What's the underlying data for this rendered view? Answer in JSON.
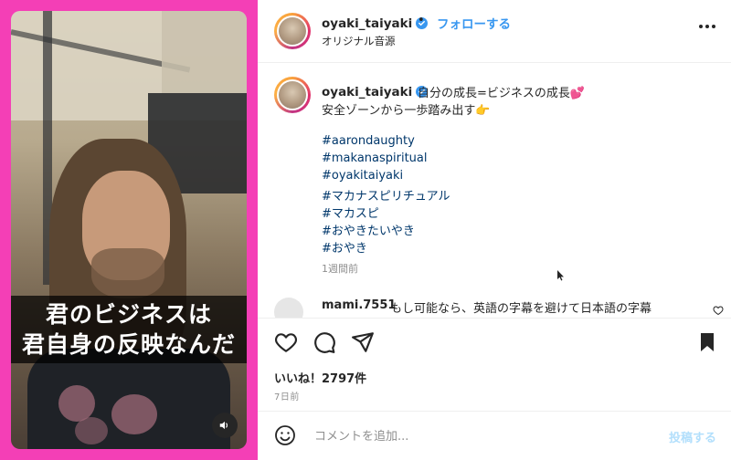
{
  "video": {
    "subtitle_line1": "君のビジネスは",
    "subtitle_line2": "君自身の反映なんだ",
    "sound_icon": "speaker-icon"
  },
  "header": {
    "username": "oyaki_taiyaki",
    "separator": "•",
    "follow_label": "フォローする",
    "audio_label": "オリジナル音源",
    "more_icon": "more-horizontal-icon"
  },
  "caption": {
    "username": "oyaki_taiyaki",
    "line1": "自分の成長=ビジネスの成長💕",
    "line2": "安全ゾーンから一歩踏み出す👉",
    "hashtags": [
      "#aarondaughty",
      "#makanaspiritual",
      "#oyakitaiyaki",
      "#マカナスピリチュアル",
      "#マカスピ",
      "#おやきたいやき",
      "#おやき"
    ],
    "time": "1週間前"
  },
  "comment": {
    "username": "mami.7551",
    "text": "もし可能なら、英語の字幕を避けて日本語の字幕"
  },
  "actions": {
    "like_icon": "heart-icon",
    "comment_icon": "comment-icon",
    "share_icon": "send-icon",
    "save_icon": "bookmark-icon"
  },
  "likes": "いいね！2797件",
  "date": "7日前",
  "comment_input": {
    "placeholder": "コメントを追加...",
    "post_label": "投稿する"
  },
  "colors": {
    "frame": "#f43fb6",
    "link": "#3897f0",
    "hashtag": "#00376b"
  }
}
